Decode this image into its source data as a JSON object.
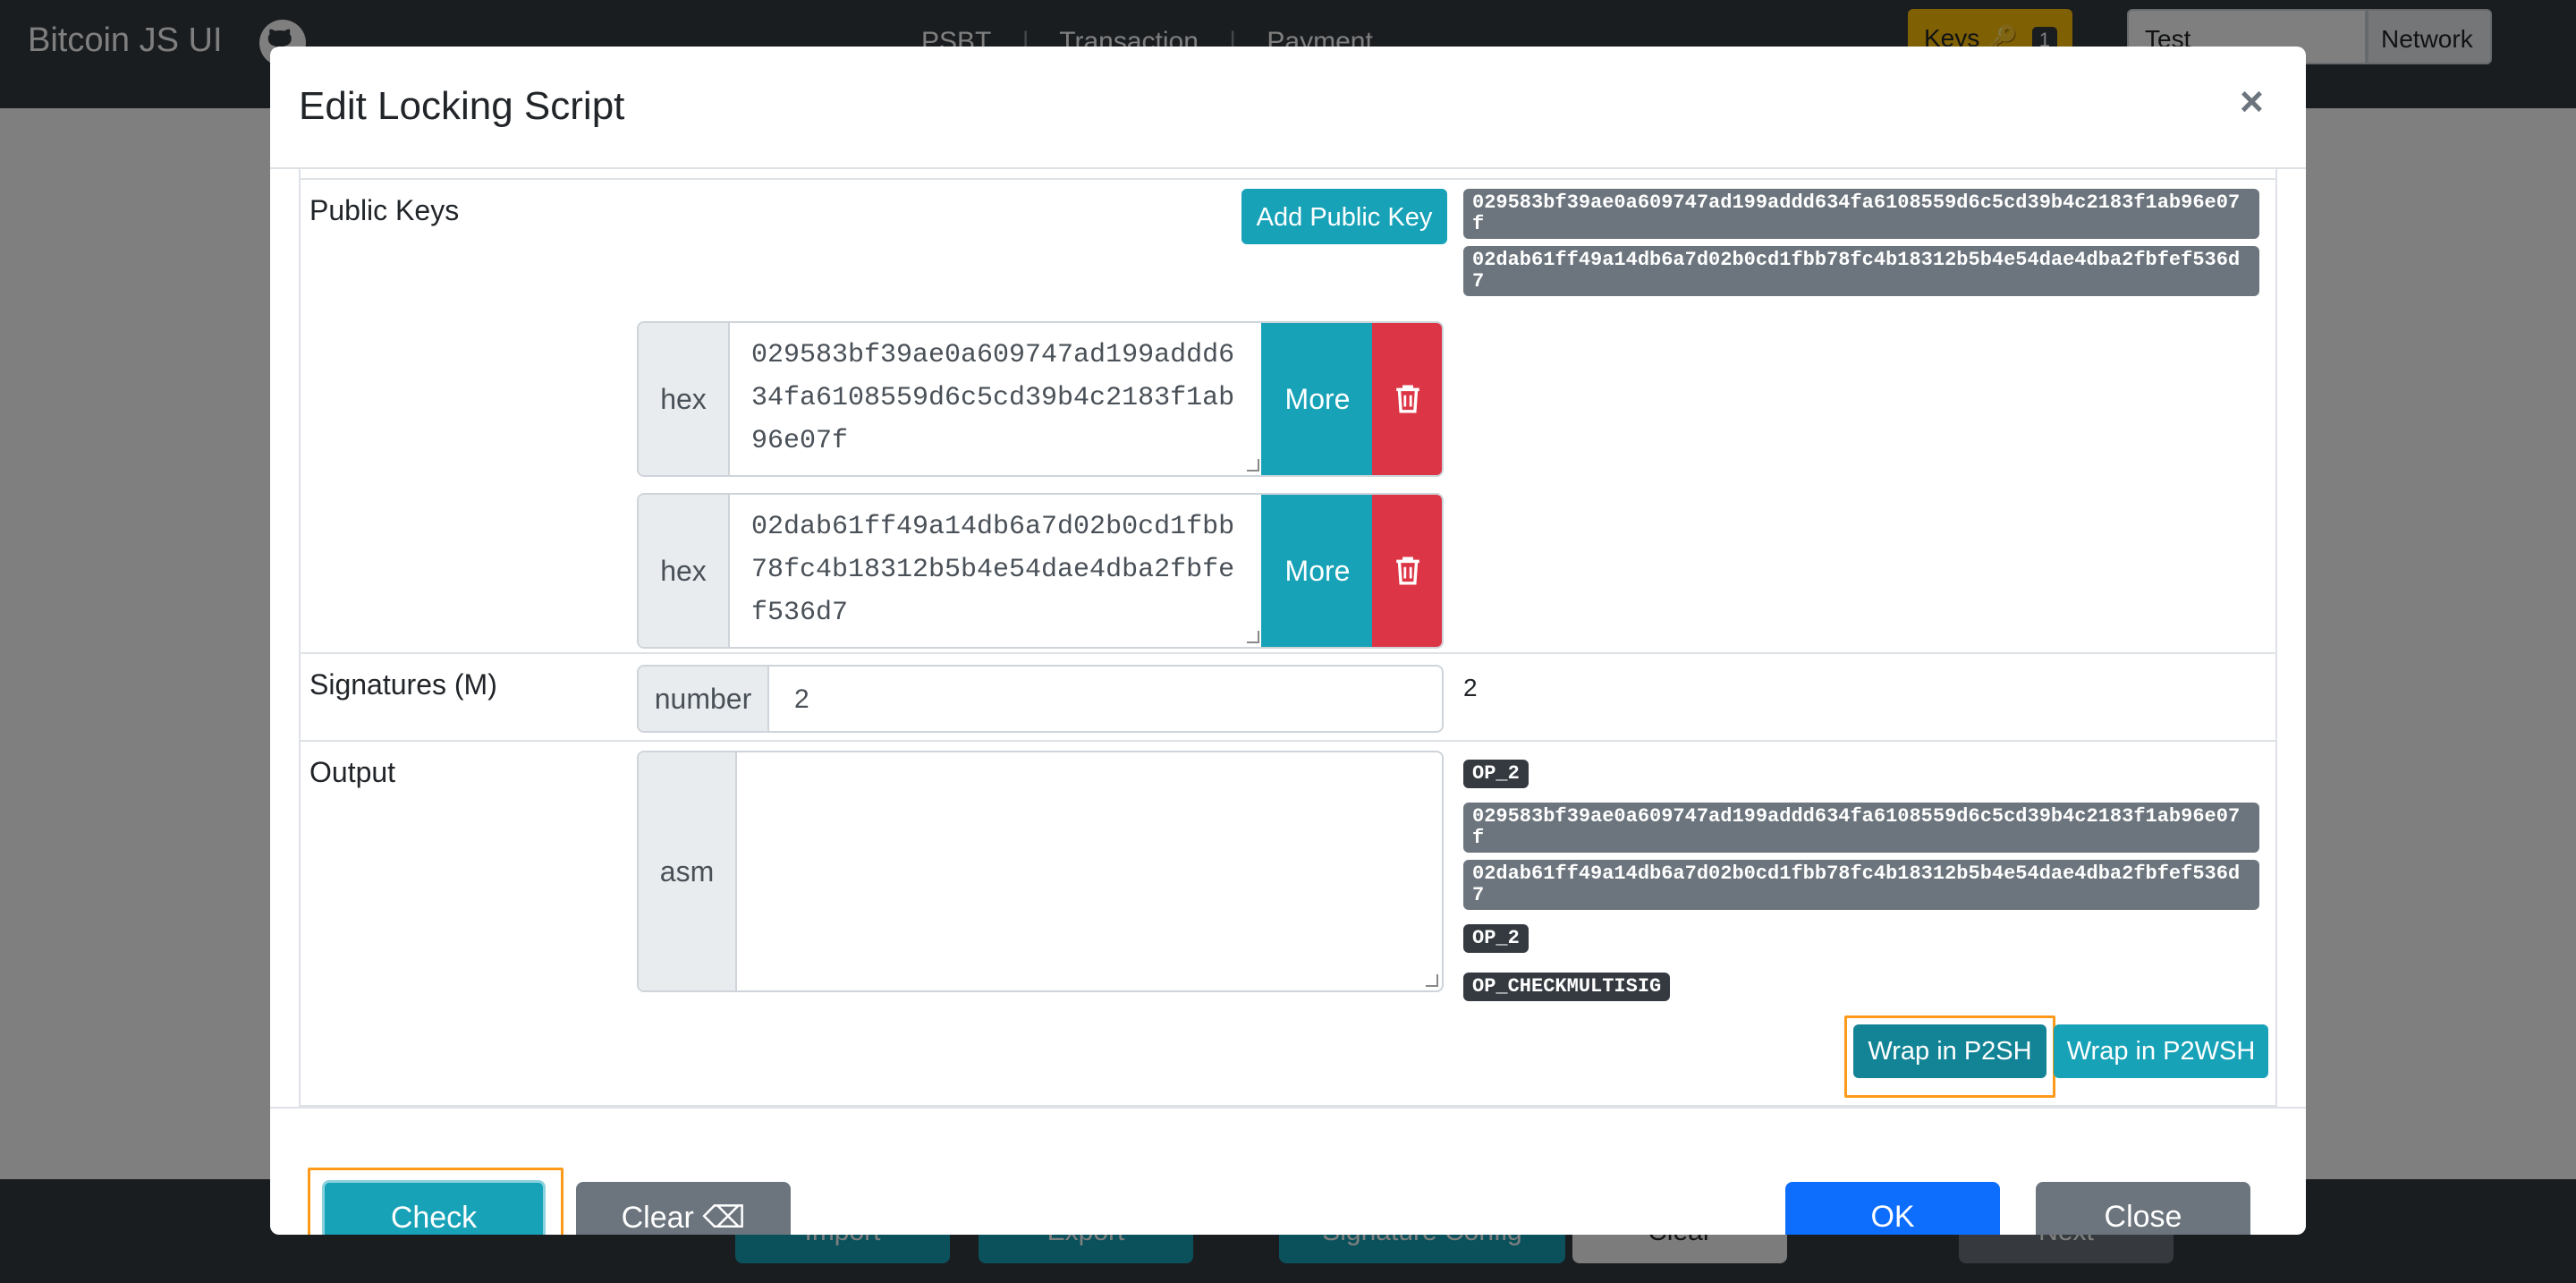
{
  "app": {
    "brand": "Bitcoin JS UI",
    "nav": [
      "PSBT",
      "Transaction",
      "Payment"
    ],
    "keys_label": "Keys",
    "keys_count": "1",
    "network_value": "Test",
    "network_label": "Network"
  },
  "bottom_bar": {
    "buttons": [
      "Import",
      "Export",
      "Signature Config",
      "Clear",
      "Next"
    ]
  },
  "modal": {
    "title": "Edit Locking Script",
    "close_symbol": "×",
    "public_keys": {
      "label": "Public Keys",
      "add_button": "Add Public Key",
      "badges": [
        "029583bf39ae0a609747ad199addd634fa6108559d6c5cd39b4c2183f1ab96e07f",
        "02dab61ff49a14db6a7d02b0cd1fbb78fc4b18312b5b4e54dae4dba2fbfef536d7"
      ],
      "inputs": [
        {
          "prefix": "hex",
          "value": "029583bf39ae0a609747ad199addd634fa6108559d6c5cd39b4c2183f1ab96e07f",
          "more": "More"
        },
        {
          "prefix": "hex",
          "value": "02dab61ff49a14db6a7d02b0cd1fbb78fc4b18312b5b4e54dae4dba2fbfef536d7",
          "more": "More"
        }
      ]
    },
    "signatures": {
      "label": "Signatures (M)",
      "prefix": "number",
      "value": "2",
      "display": "2"
    },
    "output": {
      "label": "Output",
      "prefix": "asm",
      "value": "",
      "asm_tokens": {
        "op_m": "OP_2",
        "key1": "029583bf39ae0a609747ad199addd634fa6108559d6c5cd39b4c2183f1ab96e07f",
        "key2": "02dab61ff49a14db6a7d02b0cd1fbb78fc4b18312b5b4e54dae4dba2fbfef536d7",
        "op_n": "OP_2",
        "op_check": "OP_CHECKMULTISIG"
      },
      "wrap_p2sh": "Wrap in P2SH",
      "wrap_p2wsh": "Wrap in P2WSH"
    },
    "footer": {
      "check": "Check",
      "clear": "Clear",
      "ok": "OK",
      "close": "Close"
    }
  },
  "colors": {
    "info": "#17a2b8",
    "danger": "#dc3545",
    "primary": "#0d6efd",
    "secondary": "#6c757d",
    "focus": "#fd9a1a"
  }
}
